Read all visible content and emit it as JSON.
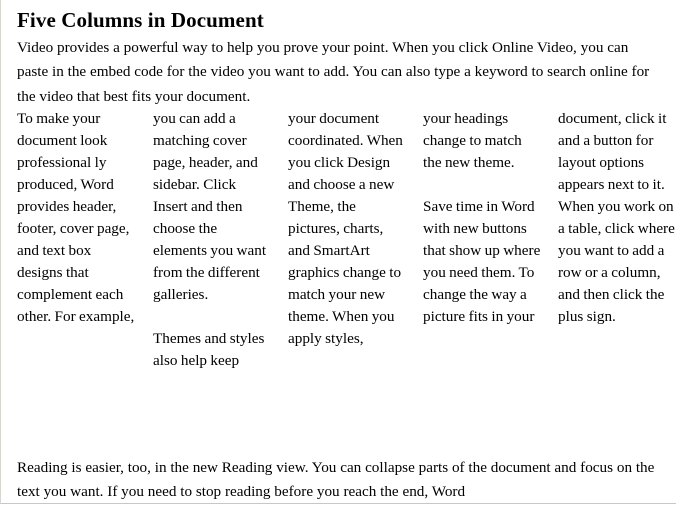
{
  "document": {
    "title": "Five Columns in Document",
    "intro_paragraph": "Video provides a powerful way to help you prove your point. When you click Online Video, you can paste in the embed code for the video you want to add. You can also type a keyword to search online for the video that best fits your document.",
    "closing_paragraph": "Reading is easier, too, in the new Reading view. You can collapse parts of the document and focus on the text you want. If you need to stop reading before you reach the end, Word",
    "column_count": 5,
    "columns": [
      {
        "index": 1,
        "paragraphs": [
          "To make your document look professional ly produced, Word provides header, footer, cover page, and text box designs that complement each other. For example,"
        ]
      },
      {
        "index": 2,
        "paragraphs": [
          "you can add a matching cover page, header, and sidebar. Click Insert and then choose the elements you want from the different galleries.",
          "Themes and styles also help keep"
        ]
      },
      {
        "index": 3,
        "paragraphs": [
          "your document coordinated. When you click Design and choose a new Theme, the pictures, charts, and SmartArt graphics change to match your new theme. When you apply styles,"
        ]
      },
      {
        "index": 4,
        "paragraphs": [
          "your headings change to match the new theme.",
          "Save time in Word with new buttons that show up where you need them. To change the way a picture fits in your"
        ]
      },
      {
        "index": 5,
        "paragraphs": [
          "document, click it and a button for layout options appears next to it. When you work on a table, click where you want to add a row or a column, and then click the plus sign."
        ]
      }
    ]
  },
  "colors": {
    "text": "#000000",
    "page_background": "#ffffff",
    "border": "#d8d6d0"
  }
}
